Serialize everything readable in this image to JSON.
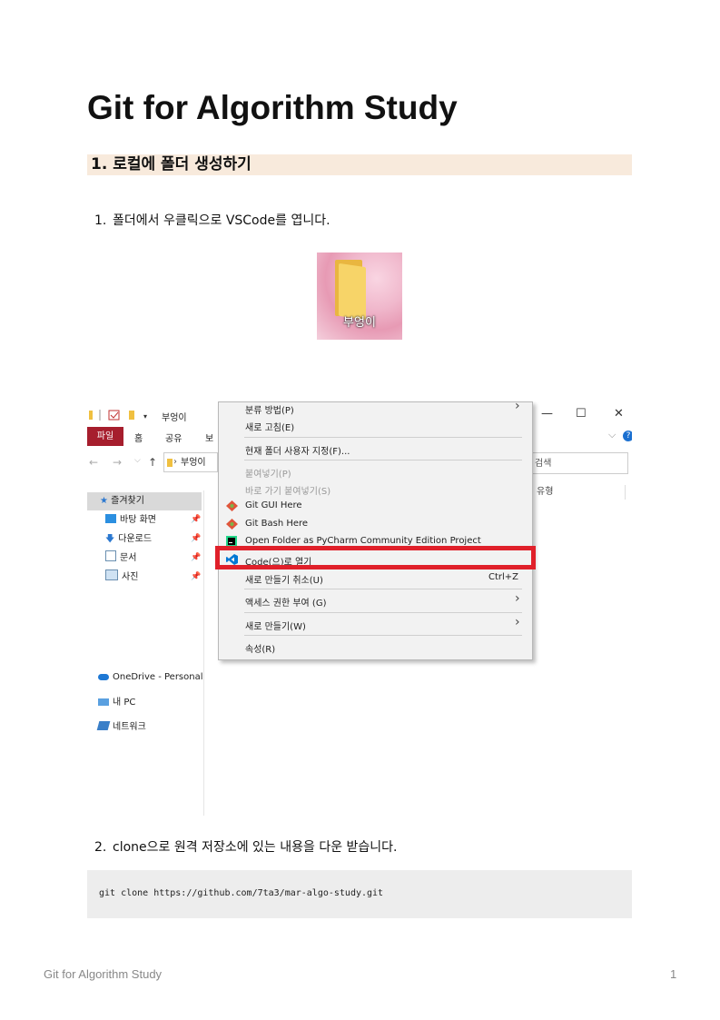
{
  "document": {
    "title": "Git for Algorithm Study",
    "section_heading": "1. 로컬에 폴더 생성하기",
    "steps": [
      {
        "number": "1.",
        "text": "폴더에서 우클릭으로 VSCode를 엽니다."
      },
      {
        "number": "2.",
        "text": "clone으로 원격 저장소에 있는 내용을 다운 받습니다."
      }
    ],
    "code": "git clone https://github.com/7ta3/mar-algo-study.git",
    "footer": {
      "left": "Git for Algorithm Study",
      "page_number": "1"
    }
  },
  "folder_thumbnail": {
    "label": "부엉이",
    "icon": "folder-icon"
  },
  "explorer": {
    "window_title": "부엉이",
    "window_buttons": [
      "—",
      "☐",
      "✕"
    ],
    "ribbon_tabs": [
      "파일",
      "홈",
      "공유",
      "보"
    ],
    "address_text": "부엉이",
    "search_placeholder": "검색",
    "column_header_type": "유형",
    "nav_items": [
      {
        "label": "즐겨찾기",
        "icon": "star-icon",
        "selected": true
      },
      {
        "label": "바탕 화면",
        "icon": "desktop-icon",
        "pinned": true
      },
      {
        "label": "다운로드",
        "icon": "download-icon",
        "pinned": true
      },
      {
        "label": "문서",
        "icon": "document-icon",
        "pinned": true
      },
      {
        "label": "사진",
        "icon": "picture-icon",
        "pinned": true
      },
      {
        "label": "OneDrive - Personal",
        "icon": "cloud-icon"
      },
      {
        "label": "내 PC",
        "icon": "computer-icon"
      },
      {
        "label": "네트워크",
        "icon": "network-icon"
      }
    ],
    "context_menu": {
      "items": [
        {
          "label": "분류 방법(P)",
          "submenu": true
        },
        {
          "label": "새로 고침(E)"
        },
        {
          "label": "현재 폴더 사용자 지정(F)..."
        },
        {
          "label": "붙여넣기(P)",
          "disabled": true
        },
        {
          "label": "바로 가기 붙여넣기(S)",
          "disabled": true
        },
        {
          "label": "Git GUI Here",
          "icon": "git-icon"
        },
        {
          "label": "Git Bash Here",
          "icon": "git-icon"
        },
        {
          "label": "Open Folder as PyCharm Community Edition Project",
          "icon": "pycharm-icon"
        },
        {
          "label": "Code(으)로 열기",
          "icon": "vscode-icon",
          "highlighted": true
        },
        {
          "label": "새로 만들기 취소(U)",
          "shortcut": "Ctrl+Z"
        },
        {
          "label": "액세스 권한 부여 (G)",
          "submenu": true
        },
        {
          "label": "새로 만들기(W)",
          "submenu": true
        },
        {
          "label": "속성(R)"
        }
      ]
    },
    "highlight_color": "#e0202a"
  },
  "colors": {
    "heading_bg": "#f8eadc",
    "code_bg": "#ededed",
    "file_tab": "#a61e2d",
    "vscode_blue": "#0078d4"
  }
}
